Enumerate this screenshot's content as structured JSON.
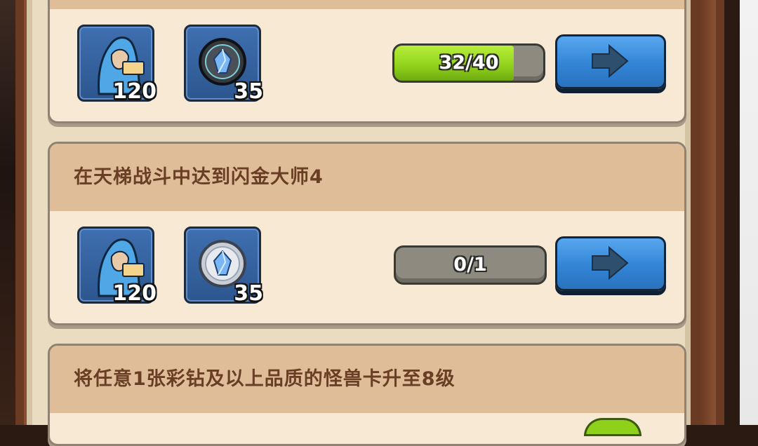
{
  "tasks": [
    {
      "title": "",
      "rewards": [
        {
          "icon": "hooded-hero-card-icon",
          "count": "120"
        },
        {
          "icon": "dark-gem-medal-icon",
          "count": "35"
        }
      ],
      "progress": {
        "label": "32/40",
        "fraction": 0.8
      },
      "go_icon": "arrow-right-icon"
    },
    {
      "title": "在天梯战斗中达到闪金大师4",
      "rewards": [
        {
          "icon": "hooded-hero-card-icon",
          "count": "120"
        },
        {
          "icon": "silver-gem-medal-icon",
          "count": "35"
        }
      ],
      "progress": {
        "label": "0/1",
        "fraction": 0
      },
      "go_icon": "arrow-right-icon"
    },
    {
      "title": "将任意1张彩钻及以上品质的怪兽卡升至8级"
    }
  ],
  "colors": {
    "parchment": "#f7e9d3",
    "header": "#dfbd98",
    "title_text": "#6a3e24",
    "progress_green": "#8fd01b",
    "button_blue": "#3285d6"
  }
}
